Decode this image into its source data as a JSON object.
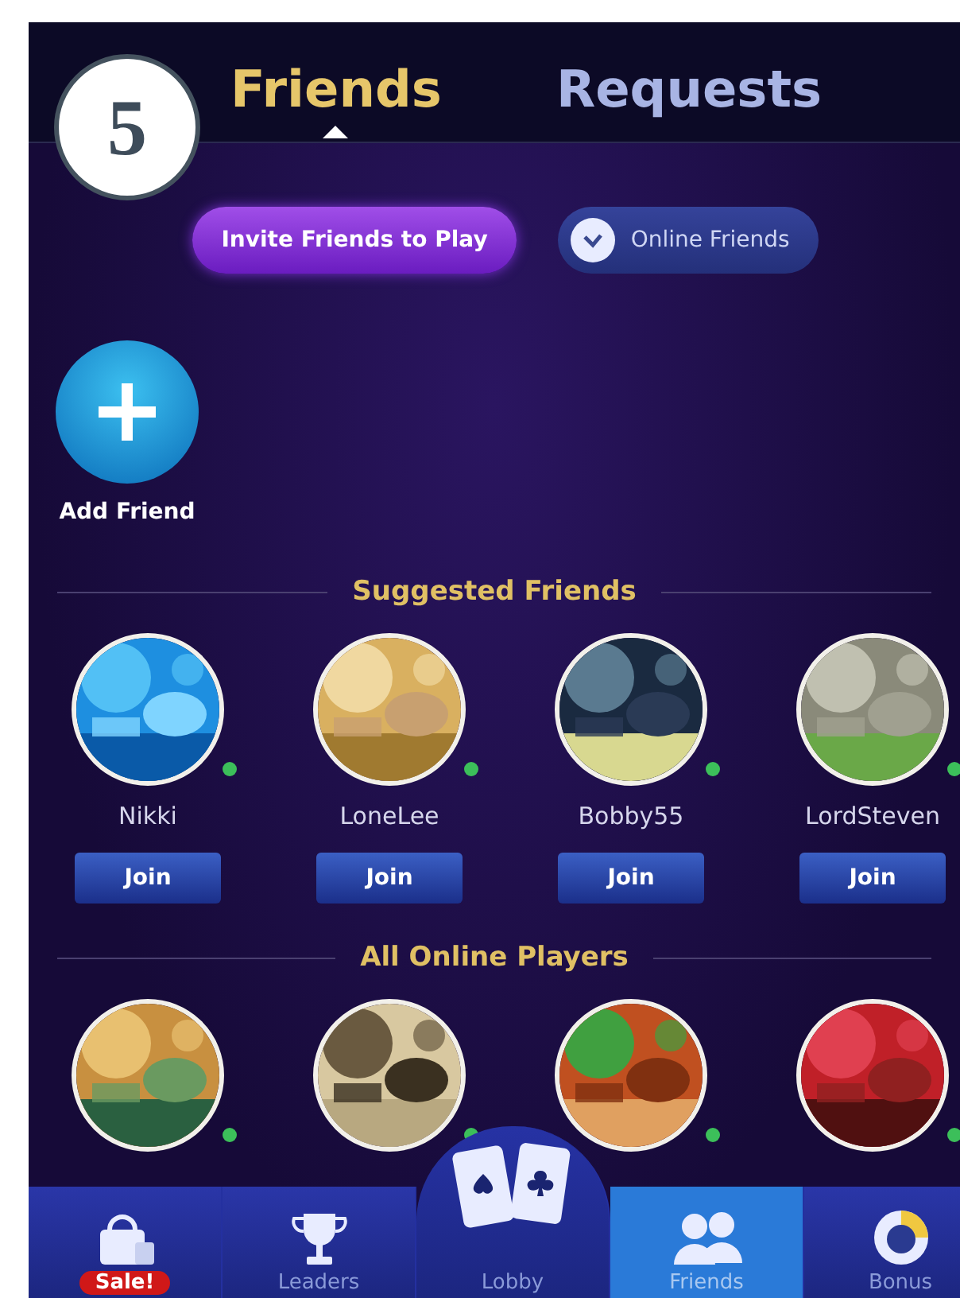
{
  "step_badge": "5",
  "tabs": [
    {
      "label": "Friends",
      "selected": true
    },
    {
      "label": "Requests",
      "selected": false
    }
  ],
  "actions": {
    "invite_button": "Invite Friends to Play",
    "online_filter": {
      "label": "Online Friends",
      "checked": true
    }
  },
  "add_friend": {
    "label": "Add Friend"
  },
  "sections": [
    {
      "title": "Suggested Friends",
      "players": [
        {
          "name": "Nikki",
          "online": true,
          "join": "Join"
        },
        {
          "name": "LoneLee",
          "online": true,
          "join": "Join"
        },
        {
          "name": "Bobby55",
          "online": true,
          "join": "Join"
        },
        {
          "name": "LordSteven",
          "online": true,
          "join": "Join"
        }
      ]
    },
    {
      "title": "All Online Players",
      "players": [
        {
          "online": true
        },
        {
          "online": true
        },
        {
          "online": true
        },
        {
          "online": true
        }
      ]
    }
  ],
  "nav": [
    {
      "label": "Sale!",
      "kind": "shop",
      "selected": false
    },
    {
      "label": "Leaders",
      "kind": "trophy",
      "selected": false
    },
    {
      "label": "Lobby",
      "kind": "cards",
      "selected": false
    },
    {
      "label": "Friends",
      "kind": "friends",
      "selected": true
    },
    {
      "label": "Bonus",
      "kind": "bonus",
      "selected": false
    }
  ]
}
